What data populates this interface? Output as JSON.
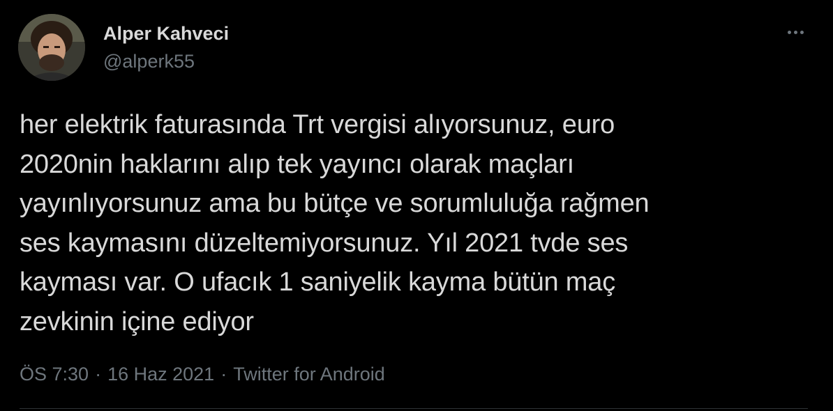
{
  "author": {
    "display_name": "Alper Kahveci",
    "handle": "@alperk55",
    "avatar_icon": "user-photo-avatar"
  },
  "tweet": {
    "lines": [
      "her elektrik faturasında Trt vergisi alıyorsunuz, euro",
      "2020nin haklarını alıp tek yayıncı olarak maçları",
      "yayınlıyorsunuz ama bu bütçe ve sorumluluğa rağmen",
      "ses kaymasını düzeltemiyorsunuz. Yıl 2021 tvde ses",
      "kayması var. O ufacık 1 saniyelik kayma bütün maç",
      "zevkinin içine ediyor"
    ]
  },
  "meta": {
    "time": "ÖS 7:30",
    "separator": "·",
    "date": "16 Haz 2021",
    "source": "Twitter for Android"
  },
  "colors": {
    "background": "#000000",
    "text_primary": "#d9d9d9",
    "text_secondary": "#6e767d",
    "divider": "#2f3336"
  },
  "icons": {
    "more": "more-horizontal-icon"
  }
}
